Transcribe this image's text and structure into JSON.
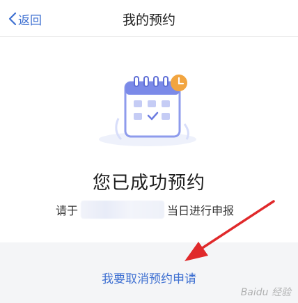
{
  "nav": {
    "back_label": "返回",
    "title": "我的预约"
  },
  "result": {
    "headline": "您已成功预约",
    "hint_prefix": "请于",
    "hint_suffix": "当日进行申报"
  },
  "actions": {
    "cancel_label": "我要取消预约申请"
  },
  "watermark": {
    "text": "Baidu 经验"
  },
  "colors": {
    "accent": "#3d6fd1",
    "calendar": "#7b8ae8",
    "clock_badge": "#f2a540",
    "arrow": "#e0292b",
    "bottom_bg": "#f4f5f7"
  },
  "icons": {
    "back": "chevron-left-icon",
    "illustration": "calendar-check-icon",
    "badge": "clock-icon"
  }
}
